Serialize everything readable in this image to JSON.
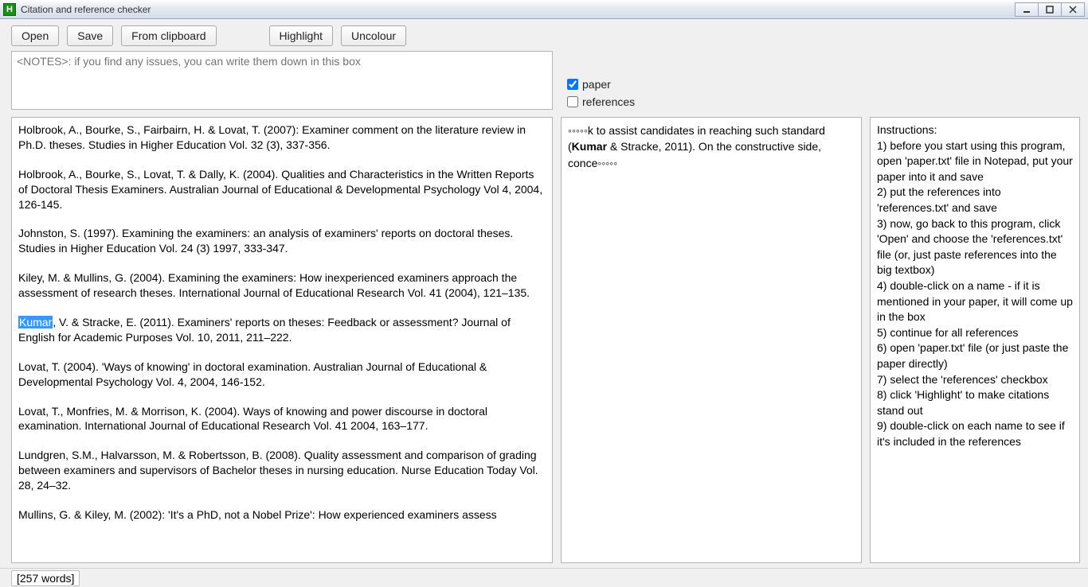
{
  "window": {
    "title": "Citation and reference checker",
    "app_icon_letter": "H"
  },
  "toolbar": {
    "open": "Open",
    "save": "Save",
    "from_clipboard": "From clipboard",
    "highlight": "Highlight",
    "uncolour": "Uncolour"
  },
  "notes": {
    "placeholder": "<NOTES>: if you find any issues, you can write them down in this box"
  },
  "checks": {
    "paper": {
      "label": "paper",
      "checked": true
    },
    "references": {
      "label": "references",
      "checked": false
    }
  },
  "references": {
    "highlighted_word": "Kumar",
    "items": [
      "Holbrook, A., Bourke, S., Fairbairn, H. & Lovat, T. (2007): Examiner comment on the literature review in Ph.D. theses. Studies in Higher Education Vol. 32 (3), 337-356.",
      "Holbrook, A., Bourke, S., Lovat, T. & Dally, K. (2004). Qualities and Characteristics in the Written Reports of Doctoral Thesis Examiners. Australian Journal of Educational & Developmental Psychology Vol 4, 2004, 126-145.",
      "Johnston, S. (1997). Examining the examiners: an analysis of examiners' reports on doctoral theses. Studies in Higher Education Vol. 24 (3) 1997, 333-347.",
      "Kiley, M. & Mullins, G. (2004). Examining the examiners: How inexperienced examiners approach the assessment of research theses. International Journal of Educational Research Vol. 41 (2004), 121–135.",
      "__HIGHLIGHT__, V. & Stracke, E. (2011). Examiners' reports on theses: Feedback or assessment? Journal of English for Academic Purposes Vol. 10, 2011, 211–222.",
      "Lovat, T. (2004). 'Ways of knowing' in doctoral examination. Australian Journal of Educational & Developmental Psychology Vol. 4, 2004, 146-152.",
      "Lovat, T., Monfries, M. & Morrison, K. (2004). Ways of knowing and power discourse in doctoral examination. International Journal of Educational Research Vol. 41 2004, 163–177.",
      "Lundgren, S.M., Halvarsson, M. & Robertsson, B. (2008). Quality assessment and comparison of grading between examiners and supervisors of Bachelor theses in nursing education. Nurse Education Today Vol. 28, 24–32.",
      "Mullins, G. & Kiley, M. (2002): 'It's a PhD, not a Nobel Prize': How experienced examiners assess"
    ]
  },
  "snippet": {
    "pre": "◦◦◦◦◦k to assist candidates in reaching such standard (",
    "bold": "Kumar",
    "post": " & Stracke, 2011). On the constructive side, conce◦◦◦◦◦"
  },
  "instructions": {
    "heading": "Instructions:",
    "lines": [
      "1) before you start using this program, open 'paper.txt' file in Notepad, put your paper into it and save",
      "2) put the references into 'references.txt' and save",
      "3) now, go back to this program, click 'Open' and choose the 'references.txt' file (or, just paste references into the big textbox)",
      "4) double-click on a name - if it is mentioned in your paper, it will come up in the box",
      "5) continue for all references",
      "6) open 'paper.txt' file (or just paste the paper directly)",
      "7) select the 'references' checkbox",
      "8) click 'Highlight' to make citations stand out",
      "9) double-click on each name to see if it's included in the references"
    ]
  },
  "status": {
    "word_count_text": "[257 words]"
  }
}
